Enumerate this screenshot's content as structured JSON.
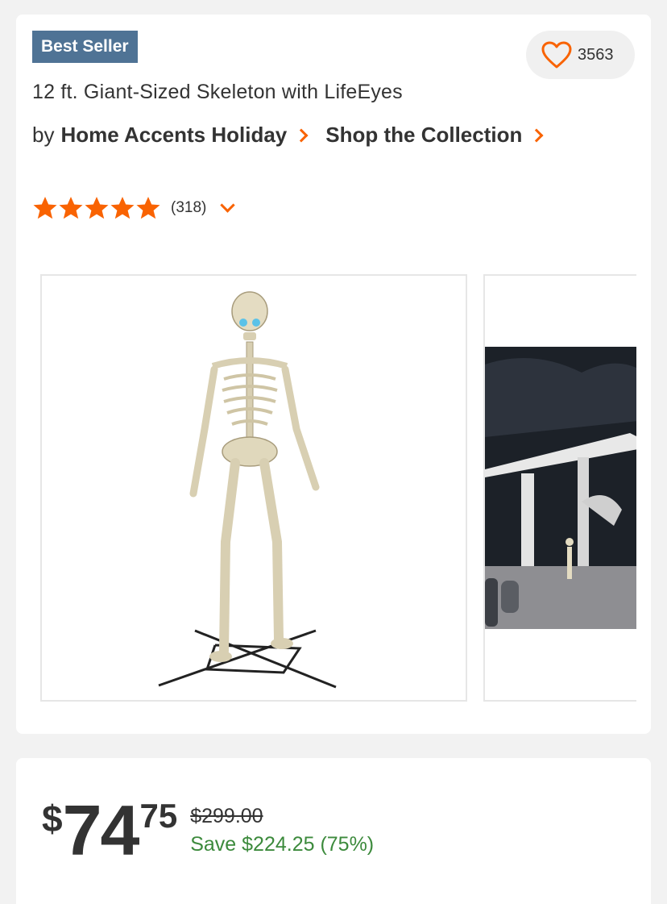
{
  "badge": {
    "label": "Best Seller"
  },
  "favorite": {
    "count": "3563",
    "icon": "heart-icon",
    "color": "#f96302"
  },
  "product": {
    "title": "12 ft. Giant-Sized Skeleton with LifeEyes",
    "by_label": "by",
    "brand": "Home Accents Holiday",
    "collection": "Shop the Collection"
  },
  "rating": {
    "stars": 5,
    "count": "(318)",
    "star_color": "#f96302"
  },
  "gallery": {
    "images": [
      {
        "name": "skeleton-product-image"
      },
      {
        "name": "skeleton-scene-image"
      }
    ]
  },
  "pricing": {
    "dollar_sign": "$",
    "whole": "74",
    "cents": "75",
    "was": "$299.00",
    "save": "Save $224.25 (75%)"
  }
}
